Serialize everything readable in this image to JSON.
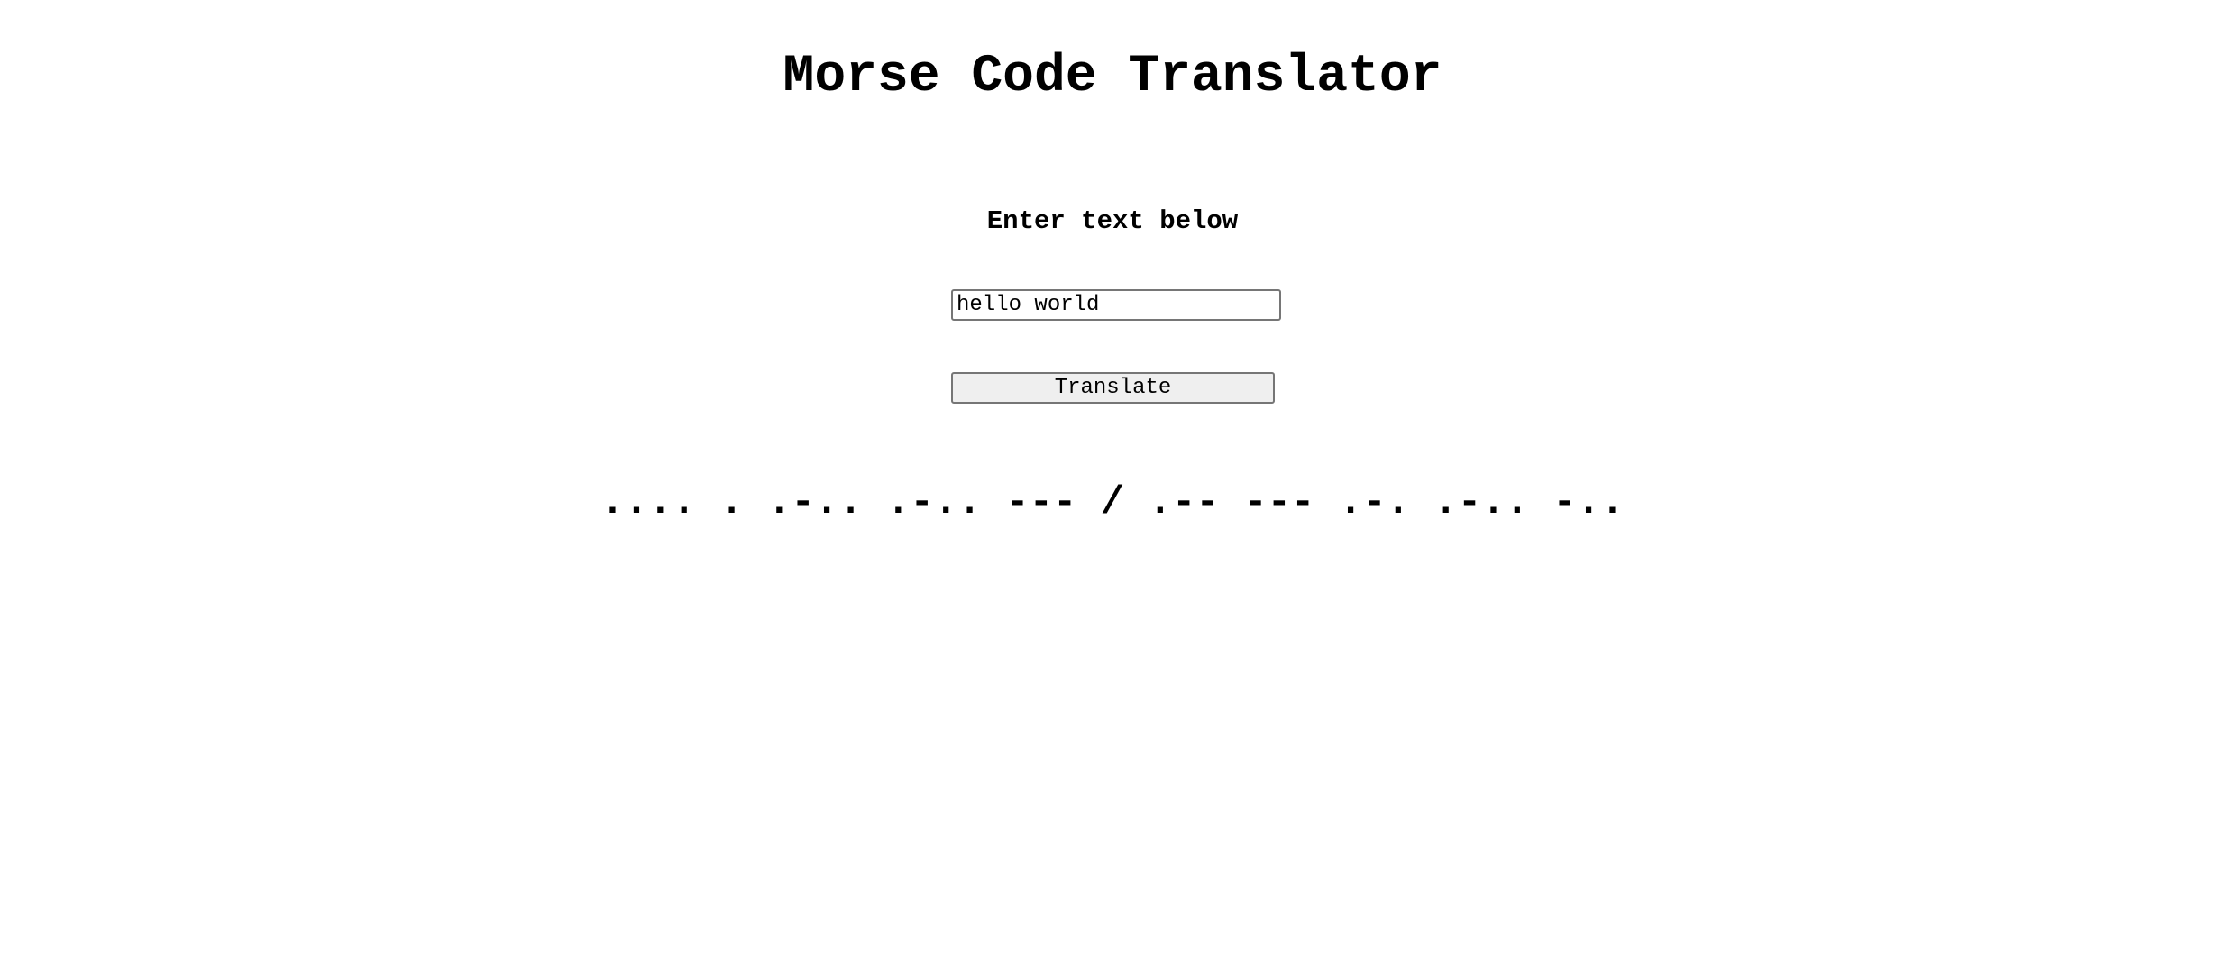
{
  "page": {
    "title": "Morse Code Translator"
  },
  "form": {
    "prompt": "Enter text below",
    "input_value": "hello world",
    "button_label": "Translate"
  },
  "output": {
    "morse": ".... . .-.. .-.. --- / .-- --- .-. .-.. -.."
  }
}
